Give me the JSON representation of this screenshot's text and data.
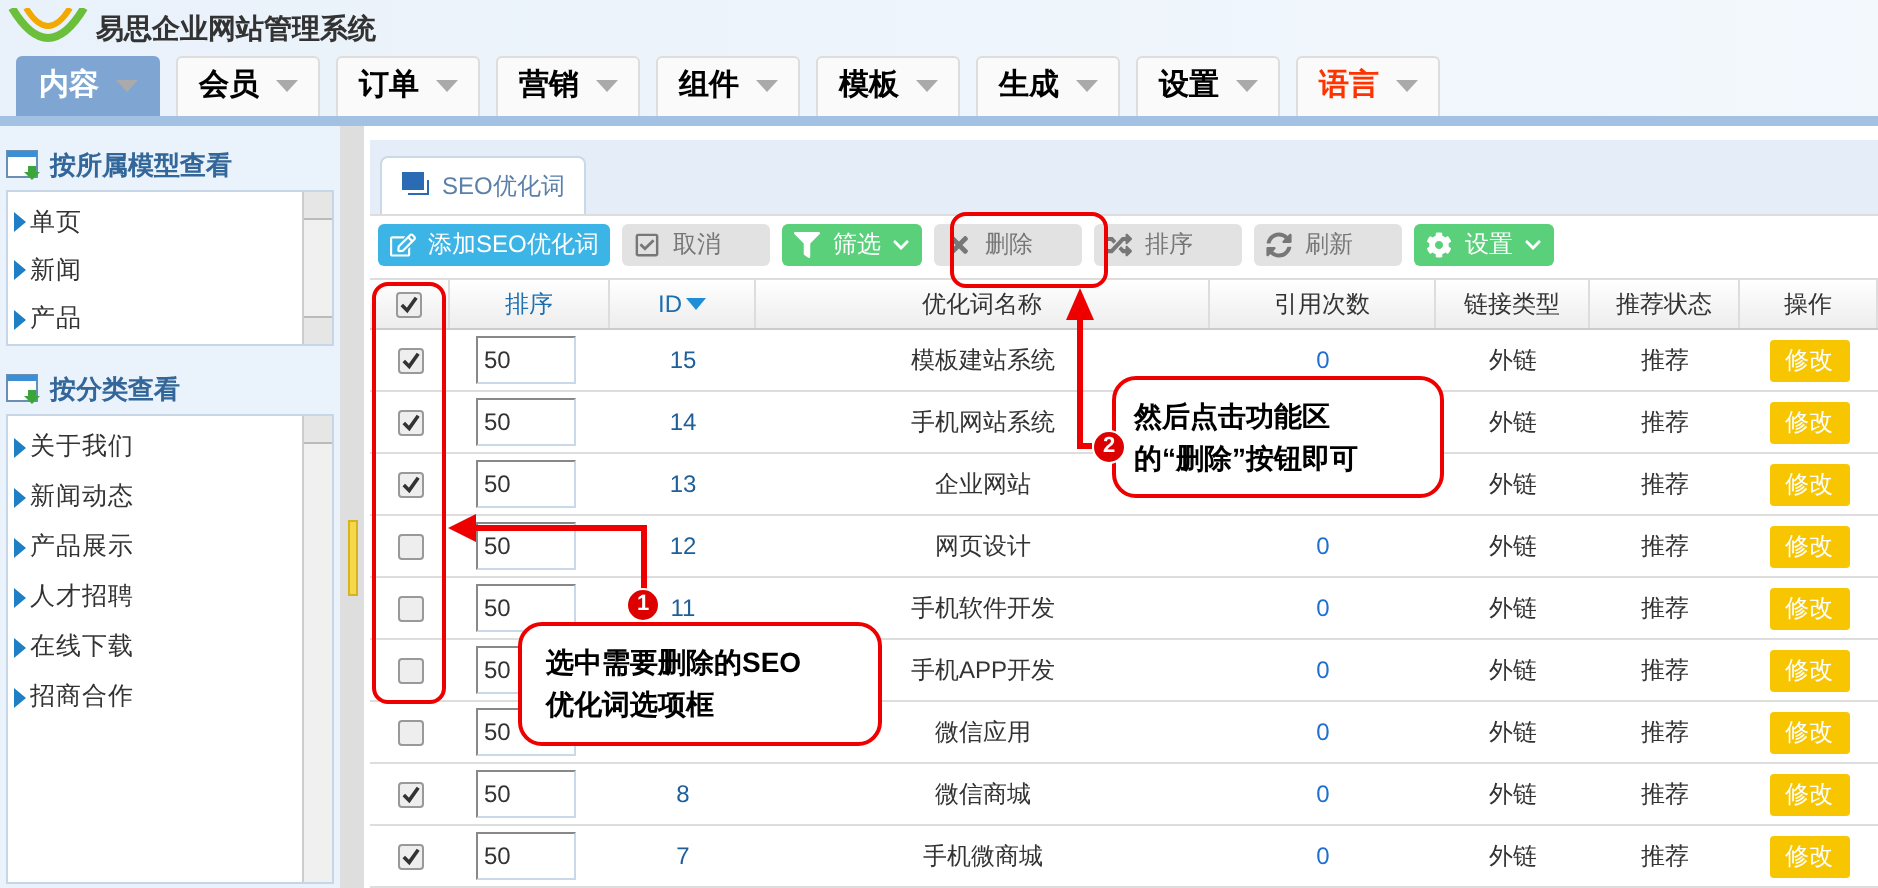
{
  "app": {
    "title": "易思企业网站管理系统"
  },
  "nav": [
    {
      "label": "内容",
      "selected": true,
      "color": "#ffffff"
    },
    {
      "label": "会员",
      "selected": false,
      "color": "#000000"
    },
    {
      "label": "订单",
      "selected": false,
      "color": "#000000"
    },
    {
      "label": "营销",
      "selected": false,
      "color": "#000000"
    },
    {
      "label": "组件",
      "selected": false,
      "color": "#000000"
    },
    {
      "label": "模板",
      "selected": false,
      "color": "#000000"
    },
    {
      "label": "生成",
      "selected": false,
      "color": "#000000"
    },
    {
      "label": "设置",
      "selected": false,
      "color": "#000000"
    },
    {
      "label": "语言",
      "selected": false,
      "color": "#ff3300"
    }
  ],
  "sidebar": [
    {
      "title": "按所属模型查看",
      "items": [
        "单页",
        "新闻",
        "产品"
      ]
    },
    {
      "title": "按分类查看",
      "items": [
        "关于我们",
        "新闻动态",
        "产品展示",
        "人才招聘",
        "在线下载",
        "招商合作"
      ]
    }
  ],
  "tab": {
    "label": "SEO优化词"
  },
  "toolbar": [
    {
      "label": "添加SEO优化词",
      "kind": "blue",
      "dropdown": false
    },
    {
      "label": "取消",
      "kind": "gray",
      "dropdown": false
    },
    {
      "label": "筛选",
      "kind": "green",
      "dropdown": true
    },
    {
      "label": "删除",
      "kind": "gray",
      "dropdown": false
    },
    {
      "label": "排序",
      "kind": "gray",
      "dropdown": false
    },
    {
      "label": "刷新",
      "kind": "gray",
      "dropdown": false
    },
    {
      "label": "设置",
      "kind": "green",
      "dropdown": true
    }
  ],
  "table": {
    "select_all": true,
    "columns": [
      "排序",
      "ID",
      "优化词名称",
      "引用次数",
      "链接类型",
      "推荐状态",
      "操作"
    ],
    "rows": [
      {
        "checked": true,
        "sort": "50",
        "id": "15",
        "name": "模板建站系统",
        "count": "0",
        "link": "外链",
        "status": "推荐",
        "action": "修改"
      },
      {
        "checked": true,
        "sort": "50",
        "id": "14",
        "name": "手机网站系统",
        "link": "外链",
        "status": "推荐",
        "action": "修改"
      },
      {
        "checked": true,
        "sort": "50",
        "id": "13",
        "name": "企业网站",
        "link": "外链",
        "status": "推荐",
        "action": "修改"
      },
      {
        "checked": false,
        "sort": "50",
        "id": "12",
        "name": "网页设计",
        "count": "0",
        "link": "外链",
        "status": "推荐",
        "action": "修改"
      },
      {
        "checked": false,
        "sort": "50",
        "id": "11",
        "name": "手机软件开发",
        "count": "0",
        "link": "外链",
        "status": "推荐",
        "action": "修改"
      },
      {
        "checked": false,
        "sort": "50",
        "name": "手机APP开发",
        "count": "0",
        "link": "外链",
        "status": "推荐",
        "action": "修改"
      },
      {
        "checked": false,
        "sort": "50",
        "name": "微信应用",
        "count": "0",
        "link": "外链",
        "status": "推荐",
        "action": "修改"
      },
      {
        "checked": true,
        "sort": "50",
        "id": "8",
        "name": "微信商城",
        "count": "0",
        "link": "外链",
        "status": "推荐",
        "action": "修改"
      },
      {
        "checked": true,
        "sort": "50",
        "id": "7",
        "name": "手机微商城",
        "count": "0",
        "link": "外链",
        "status": "推荐",
        "action": "修改"
      }
    ]
  },
  "callouts": [
    {
      "badge": "1",
      "text": "选中需要删除的SEO优化词选项框"
    },
    {
      "badge": "2",
      "text": "然后点击功能区的“删除”按钮即可"
    }
  ]
}
